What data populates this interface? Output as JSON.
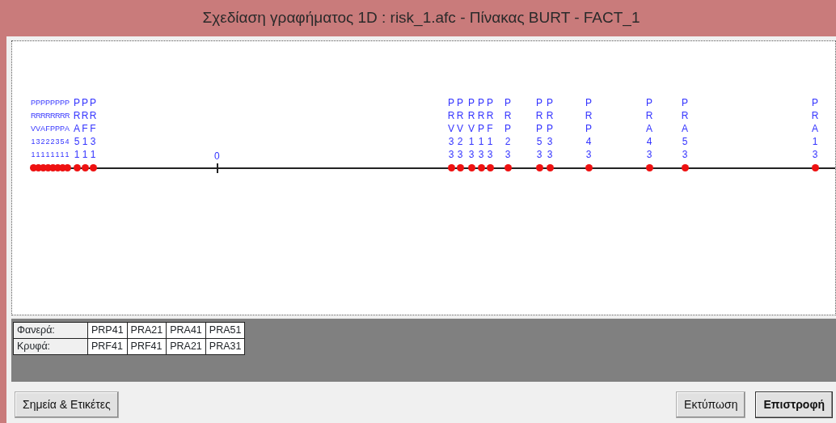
{
  "window": {
    "title": "Σχεδίαση γραφήματος 1D : risk_1.afc  -  Πίνακας BURT  -  FACT_1"
  },
  "plot": {
    "origin_label": "0",
    "points": [
      {
        "label": "PRV11"
      },
      {
        "label": "PRV31"
      },
      {
        "label": "PRA21"
      },
      {
        "label": "PRF21"
      },
      {
        "label": "PRP21"
      },
      {
        "label": "PRP31"
      },
      {
        "label": "PRP51"
      },
      {
        "label": "PRA41"
      },
      {
        "label": "PRA51"
      },
      {
        "label": "PRF11"
      },
      {
        "label": "PRF31"
      },
      {
        "label": "PRV33"
      },
      {
        "label": "PRV23"
      },
      {
        "label": "PRV13"
      },
      {
        "label": "PRP13"
      },
      {
        "label": "PRF13"
      },
      {
        "label": "PRP23"
      },
      {
        "label": "PRP53"
      },
      {
        "label": "PRP33"
      },
      {
        "label": "PRP43"
      },
      {
        "label": "PRA43"
      },
      {
        "label": "PRA53"
      },
      {
        "label": "PRA13"
      }
    ]
  },
  "table": {
    "rows": [
      {
        "label": "Φανερά:",
        "cells": [
          "PRP41",
          "PRA21",
          "PRA41",
          "PRA51"
        ]
      },
      {
        "label": "Κρυφά:",
        "cells": [
          "PRF41",
          "PRF41",
          "PRA21",
          "PRA31"
        ]
      }
    ]
  },
  "buttons": [
    {
      "label": "Σημεία & Ετικέτες",
      "kind": "left",
      "default": false
    },
    {
      "label": "Εκτύπωση",
      "kind": "right",
      "default": false
    },
    {
      "label": "Επιστροφή",
      "kind": "right",
      "default": true
    }
  ]
}
